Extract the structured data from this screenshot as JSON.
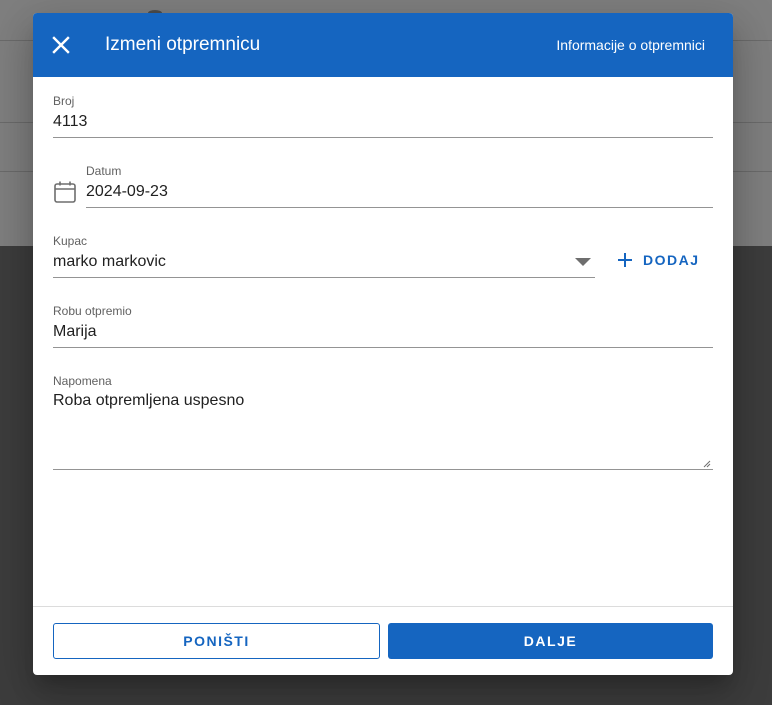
{
  "dialog": {
    "title": "Izmeni otpremnicu",
    "info_link": "Informacije o otpremnici"
  },
  "fields": {
    "broj": {
      "label": "Broj",
      "value": "4113"
    },
    "datum": {
      "label": "Datum",
      "value": "2024-09-23",
      "icon": "calendar-icon"
    },
    "kupac": {
      "label": "Kupac",
      "value": "marko markovic"
    },
    "robu_otpremio": {
      "label": "Robu otpremio",
      "value": "Marija"
    },
    "napomena": {
      "label": "Napomena",
      "value": "Roba otpremljena uspesno"
    }
  },
  "add_button": {
    "label": "DODAJ"
  },
  "footer": {
    "cancel_label": "PONIŠTI",
    "next_label": "DALJE"
  },
  "colors": {
    "primary": "#1565c0",
    "overlay": "rgba(0,0,0,0.5)"
  }
}
